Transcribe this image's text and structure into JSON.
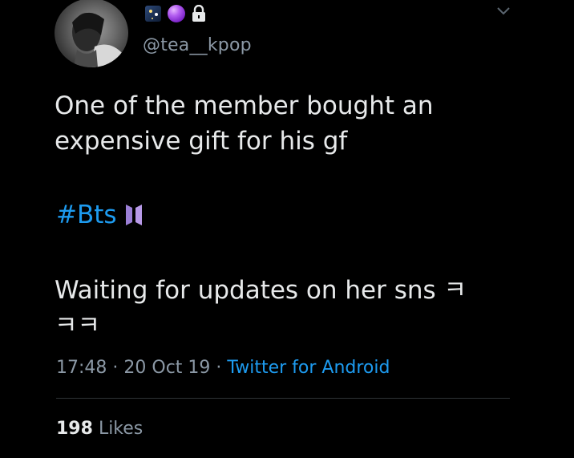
{
  "tweet": {
    "handle": "@tea__kpop",
    "name_icons": [
      "night-sky-emoji-icon",
      "crystal-ball-emoji-icon",
      "lock-icon"
    ],
    "text_lines": [
      "One of the member bought an",
      "expensive gift for his gf",
      "Waiting for updates on her sns ㅋ",
      "ㅋㅋ"
    ],
    "hashtag": "#Bts",
    "hashtag_icon": "bts-logo-icon",
    "time": "17:48",
    "separator": "·",
    "date": "20 Oct 19",
    "source": "Twitter for Android",
    "likes_count": "198",
    "likes_label": "Likes"
  },
  "colors": {
    "background": "#000000",
    "text": "#e7e9ea",
    "muted": "#8b98a5",
    "link": "#1d9bf0",
    "divider": "#2f3336"
  }
}
